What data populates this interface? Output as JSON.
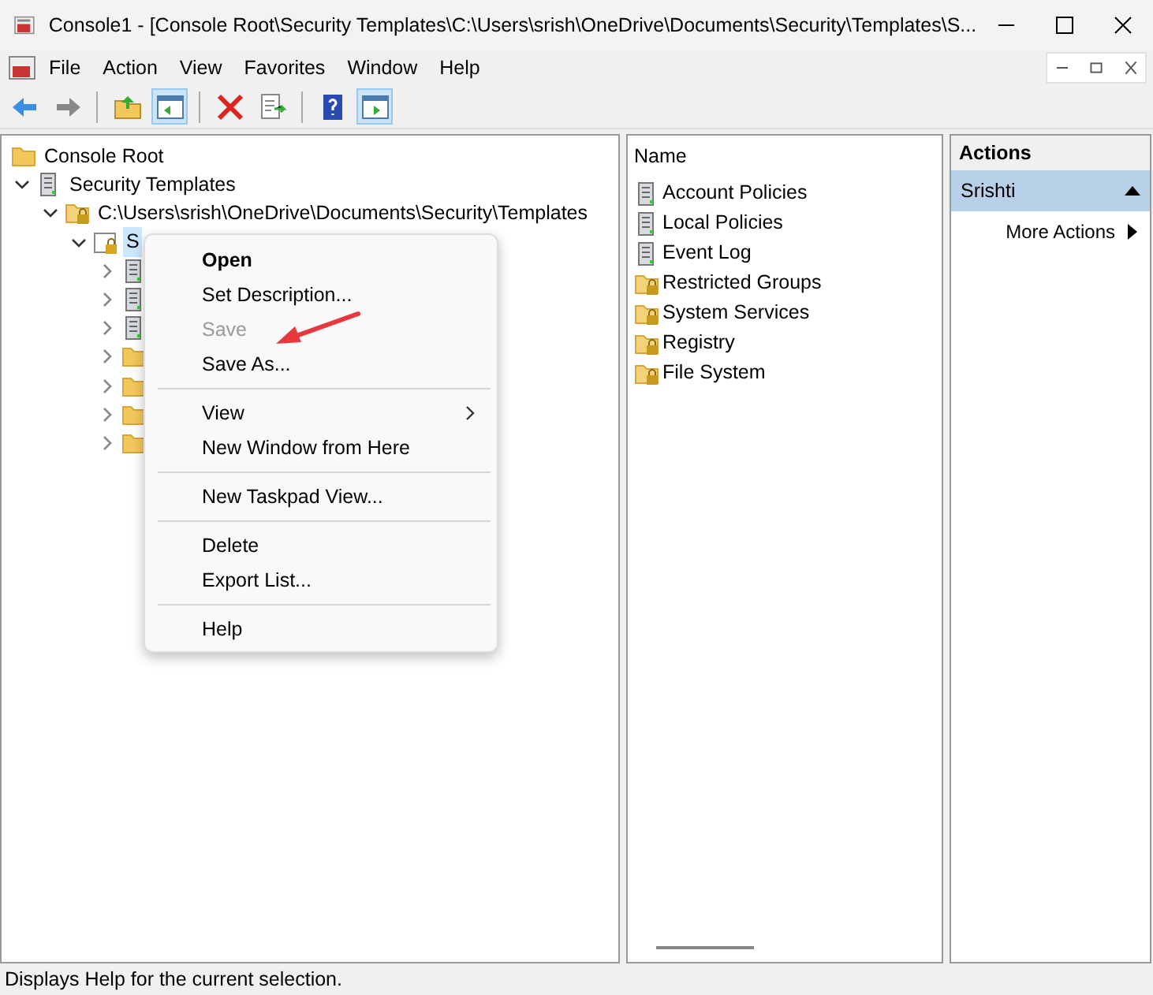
{
  "window": {
    "title": "Console1 - [Console Root\\Security Templates\\C:\\Users\\srish\\OneDrive\\Documents\\Security\\Templates\\S..."
  },
  "menu_bar": [
    "File",
    "Action",
    "View",
    "Favorites",
    "Window",
    "Help"
  ],
  "toolbar": [
    {
      "kind": "back"
    },
    {
      "kind": "forward"
    },
    {
      "kind": "sep"
    },
    {
      "kind": "up"
    },
    {
      "kind": "tree",
      "selected": true
    },
    {
      "kind": "sep"
    },
    {
      "kind": "delete"
    },
    {
      "kind": "export"
    },
    {
      "kind": "sep"
    },
    {
      "kind": "help"
    },
    {
      "kind": "actionpane",
      "selected": true
    }
  ],
  "tree": [
    {
      "label": "Console Root",
      "kind": "folder",
      "children": [
        {
          "label": "Security Templates",
          "kind": "server",
          "expanded": true,
          "children": [
            {
              "label": "C:\\Users\\srish\\OneDrive\\Documents\\Security\\Templates",
              "kind": "lockfolder",
              "expanded": true,
              "children": [
                {
                  "label": "S",
                  "kind": "template",
                  "expanded": true,
                  "selected": true,
                  "children": [
                    {
                      "kind": "server"
                    },
                    {
                      "kind": "server"
                    },
                    {
                      "kind": "server"
                    },
                    {
                      "kind": "folder"
                    },
                    {
                      "kind": "folder"
                    },
                    {
                      "kind": "folder"
                    },
                    {
                      "kind": "folder"
                    }
                  ]
                }
              ]
            }
          ]
        }
      ]
    }
  ],
  "list": {
    "column": "Name",
    "items": [
      {
        "label": "Account Policies",
        "kind": "server"
      },
      {
        "label": "Local Policies",
        "kind": "server"
      },
      {
        "label": "Event Log",
        "kind": "server"
      },
      {
        "label": "Restricted Groups",
        "kind": "lockfolder"
      },
      {
        "label": "System Services",
        "kind": "lockfolder"
      },
      {
        "label": "Registry",
        "kind": "lockfolder"
      },
      {
        "label": "File System",
        "kind": "lockfolder"
      }
    ]
  },
  "actions": {
    "title": "Actions",
    "section": "Srishti",
    "expanded": true,
    "items": [
      {
        "label": "More Actions",
        "submenu": true
      }
    ]
  },
  "context_menu": [
    {
      "kind": "item",
      "label": "Open",
      "default": true,
      "disabled": false
    },
    {
      "kind": "item",
      "label": "Set Description...",
      "default": false,
      "disabled": false
    },
    {
      "kind": "item",
      "label": "Save",
      "default": false,
      "disabled": true
    },
    {
      "kind": "item",
      "label": "Save As...",
      "default": false,
      "disabled": false
    },
    {
      "kind": "sep"
    },
    {
      "kind": "item",
      "label": "View",
      "default": false,
      "disabled": false,
      "submenu": true
    },
    {
      "kind": "item",
      "label": "New Window from Here",
      "default": false,
      "disabled": false
    },
    {
      "kind": "sep"
    },
    {
      "kind": "item",
      "label": "New Taskpad View...",
      "default": false,
      "disabled": false
    },
    {
      "kind": "sep"
    },
    {
      "kind": "item",
      "label": "Delete",
      "default": false,
      "disabled": false
    },
    {
      "kind": "item",
      "label": "Export List...",
      "default": false,
      "disabled": false
    },
    {
      "kind": "sep"
    },
    {
      "kind": "item",
      "label": "Help",
      "default": false,
      "disabled": false
    }
  ],
  "annotation": {
    "kind": "arrow"
  },
  "status_bar": "Displays Help for the current selection."
}
